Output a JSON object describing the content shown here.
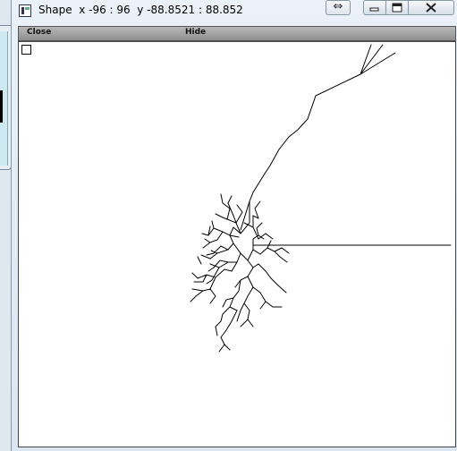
{
  "window": {
    "title": "Shape  x -96 : 96  y -88.8521 : 88.852",
    "icon": "app-icon",
    "resize_icon": "⇔",
    "minimize_icon": "minimize-icon",
    "maximize_icon": "maximize-icon",
    "close_icon": "close-icon"
  },
  "toolbar": {
    "close_label": "Close",
    "hide_label": "Hide"
  },
  "canvas": {
    "x_range": [
      -96,
      96
    ],
    "y_range": [
      -88.8521,
      88.852
    ],
    "stroke_color": "#000000",
    "background": "#ffffff"
  }
}
